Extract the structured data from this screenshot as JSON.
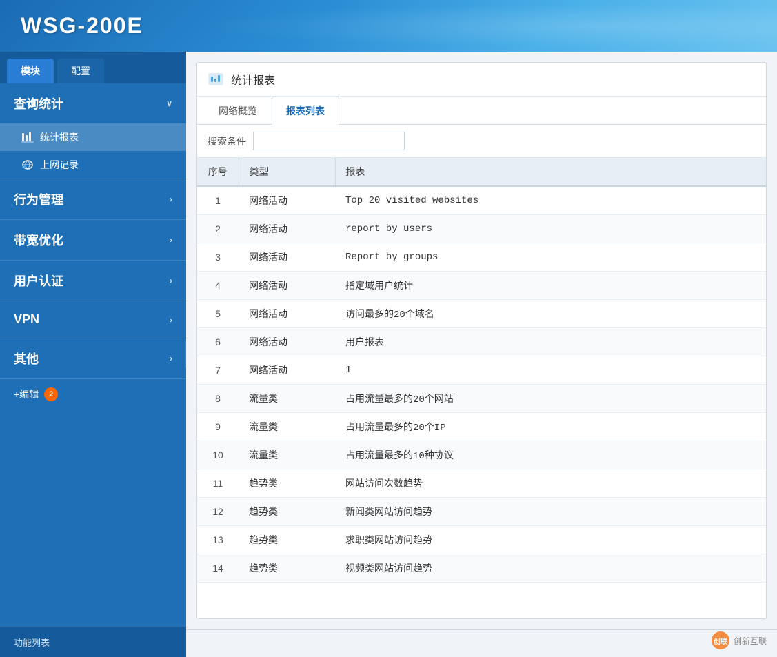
{
  "header": {
    "title": "WSG-200E"
  },
  "sidebar": {
    "tab_module": "模块",
    "tab_config": "配置",
    "sections": [
      {
        "id": "query-stats",
        "label": "查询统计",
        "has_arrow": true,
        "arrow": "∨",
        "expanded": true,
        "items": [
          {
            "id": "stats-report",
            "label": "统计报表",
            "icon": "chart"
          },
          {
            "id": "web-log",
            "label": "上网记录",
            "icon": "globe"
          }
        ]
      },
      {
        "id": "behavior",
        "label": "行为管理",
        "has_arrow": true,
        "arrow": "›",
        "expanded": false,
        "items": []
      },
      {
        "id": "bandwidth",
        "label": "带宽优化",
        "has_arrow": true,
        "arrow": "›",
        "expanded": false,
        "items": []
      },
      {
        "id": "user-auth",
        "label": "用户认证",
        "has_arrow": true,
        "arrow": "›",
        "expanded": false,
        "items": []
      },
      {
        "id": "vpn",
        "label": "VPN",
        "has_arrow": true,
        "arrow": "›",
        "expanded": false,
        "items": []
      },
      {
        "id": "other",
        "label": "其他",
        "has_arrow": true,
        "arrow": "›",
        "expanded": false,
        "items": []
      }
    ],
    "edit_label": "+编辑",
    "edit_badge": "2",
    "footer_label": "功能列表"
  },
  "page": {
    "header_icon": "chart-icon",
    "header_title": "统计报表",
    "tabs": [
      {
        "id": "network-overview",
        "label": "网络概览",
        "active": false
      },
      {
        "id": "report-list",
        "label": "报表列表",
        "active": true
      }
    ],
    "search_label": "搜索条件",
    "search_placeholder": "",
    "table": {
      "columns": [
        {
          "id": "seq",
          "label": "序号"
        },
        {
          "id": "type",
          "label": "类型"
        },
        {
          "id": "report",
          "label": "报表"
        }
      ],
      "rows": [
        {
          "seq": "1",
          "type": "网络活动",
          "report": "Top  20  visited  websites"
        },
        {
          "seq": "2",
          "type": "网络活动",
          "report": "report  by  users"
        },
        {
          "seq": "3",
          "type": "网络活动",
          "report": "Report  by  groups"
        },
        {
          "seq": "4",
          "type": "网络活动",
          "report": "指定域用户统计"
        },
        {
          "seq": "5",
          "type": "网络活动",
          "report": "访问最多的20个域名"
        },
        {
          "seq": "6",
          "type": "网络活动",
          "report": "用户报表"
        },
        {
          "seq": "7",
          "type": "网络活动",
          "report": "1"
        },
        {
          "seq": "8",
          "type": "流量类",
          "report": "占用流量最多的20个网站"
        },
        {
          "seq": "9",
          "type": "流量类",
          "report": "占用流量最多的20个IP"
        },
        {
          "seq": "10",
          "type": "流量类",
          "report": "占用流量最多的10种协议"
        },
        {
          "seq": "11",
          "type": "趋势类",
          "report": "网站访问次数趋势"
        },
        {
          "seq": "12",
          "type": "趋势类",
          "report": "新闻类网站访问趋势"
        },
        {
          "seq": "13",
          "type": "趋势类",
          "report": "求职类网站访问趋势"
        },
        {
          "seq": "14",
          "type": "趋势类",
          "report": "视频类网站访问趋势"
        }
      ]
    }
  },
  "logo": {
    "text": "创新互联"
  }
}
